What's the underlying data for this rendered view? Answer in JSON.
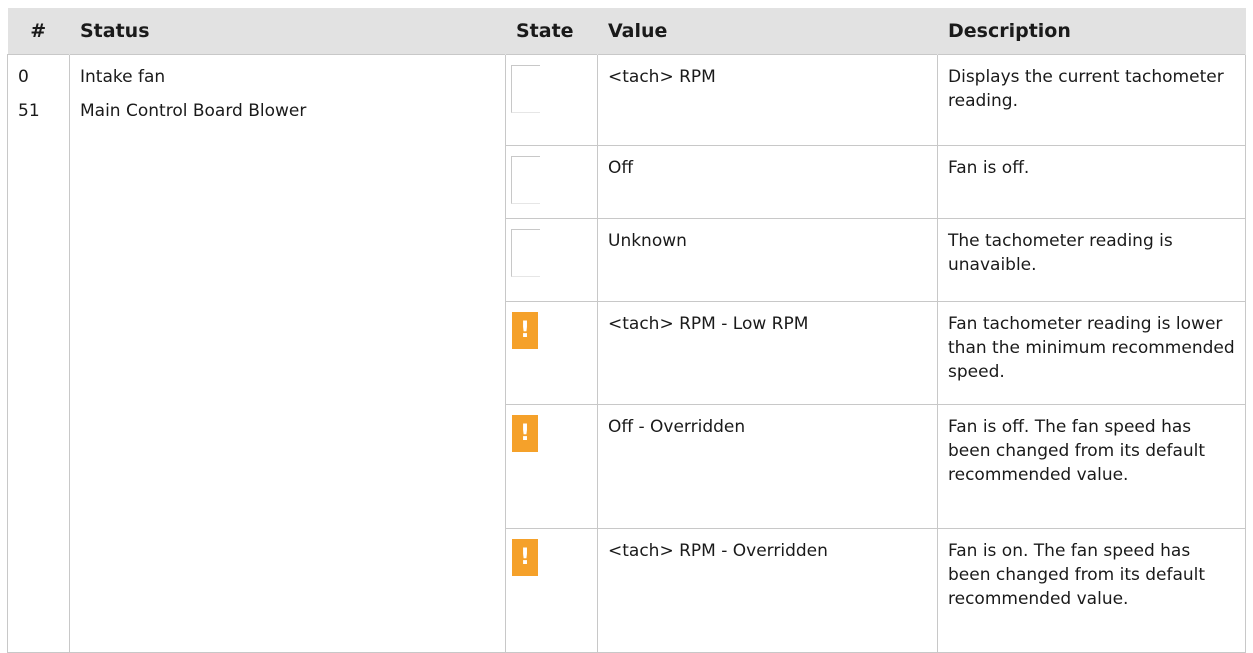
{
  "table": {
    "headers": {
      "num": "#",
      "status": "Status",
      "state": "State",
      "value": "Value",
      "description": "Description"
    },
    "nums": [
      "0",
      "51"
    ],
    "statuses": [
      "Intake fan",
      "Main Control Board Blower"
    ],
    "rows": [
      {
        "state_icon": "blank",
        "value": "<tach> RPM",
        "description": "Displays the current tachometer reading."
      },
      {
        "state_icon": "blank",
        "value": "Off",
        "description": "Fan is off."
      },
      {
        "state_icon": "blank",
        "value": "Unknown",
        "description": "The tachometer reading is unavaible."
      },
      {
        "state_icon": "warning-icon",
        "value": "<tach> RPM - Low RPM",
        "description": "Fan tachometer reading is lower than the minimum recommended speed."
      },
      {
        "state_icon": "warning-icon",
        "value": "Off - Overridden",
        "description": "Fan is off. The fan speed has been changed from its default recommended value."
      },
      {
        "state_icon": "warning-icon",
        "value": "<tach> RPM - Overridden",
        "description": "Fan is on. The fan speed has been changed from its default recommended value."
      }
    ],
    "warning_glyph": "!",
    "warning_color": "#f5a12a",
    "header_bg": "#e2e2e2"
  }
}
